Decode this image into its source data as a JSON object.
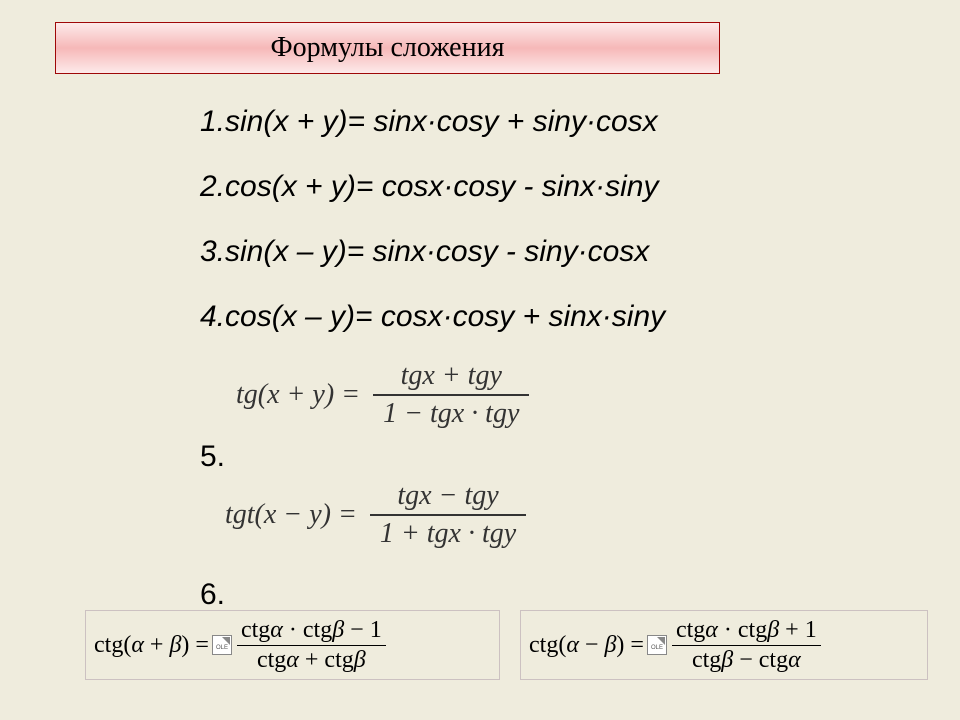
{
  "title": "Формулы сложения",
  "lines": {
    "l1": "1.sin(x + y)= sinx·cosy + siny·cosx",
    "l2": "2.cos(x + y)= cosx·cosy - sinx·siny",
    "l3": "3.sin(x – y)= sinx·cosy - siny·cosx",
    "l4": "4.cos(x – y)= cosx·cosy + sinx·siny"
  },
  "numbers": {
    "n5": "5.",
    "n6": "6."
  },
  "tg1": {
    "lhs": "tg(x + y) =",
    "num": "tgx + tgy",
    "den": "1 − tgx · tgy"
  },
  "tg2": {
    "lhs": "tgt(x − y) =",
    "num": "tgx − tgy",
    "den": "1 + tgx · tgy"
  },
  "ctg1": {
    "lhs": "ctg(α + β) =",
    "num": "ctgα · ctgβ − 1",
    "den": "ctgα + ctgβ"
  },
  "ctg2": {
    "lhs": "ctg(α − β) =",
    "num": "ctgα · ctgβ + 1",
    "den": "ctgβ − ctgα"
  },
  "ole_label": "OLE"
}
